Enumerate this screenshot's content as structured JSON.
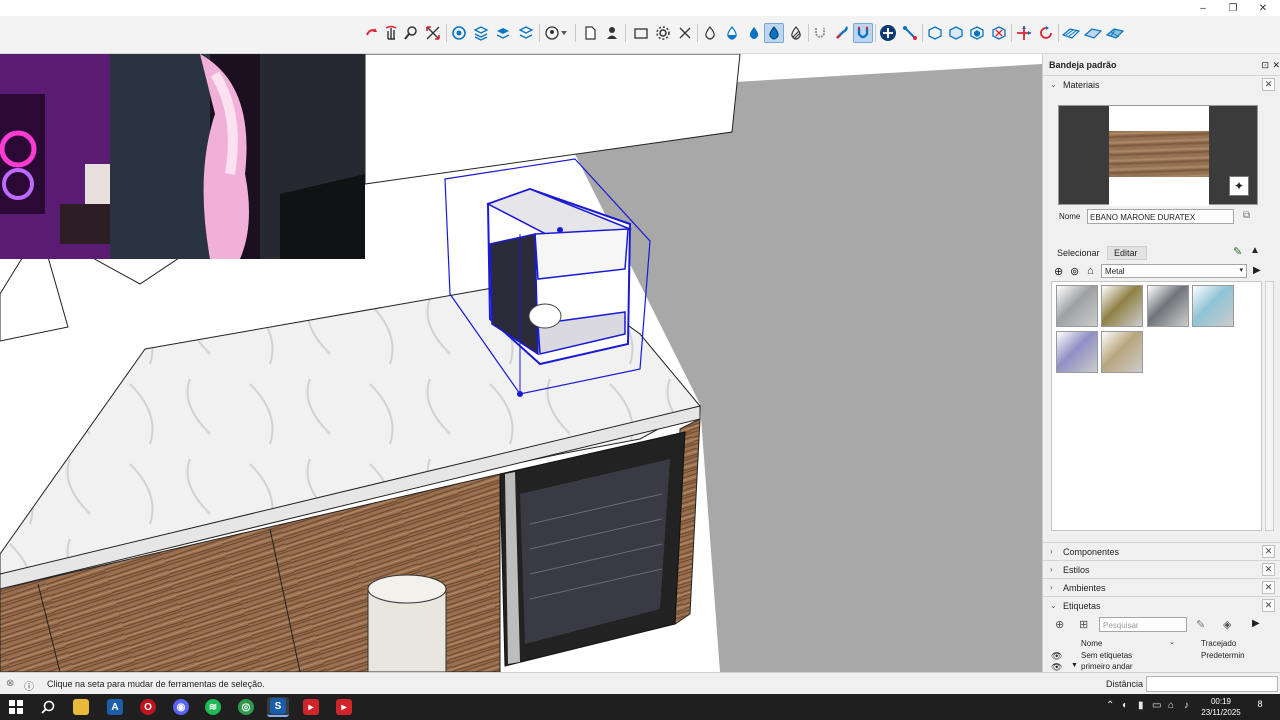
{
  "window": {
    "minimize": "–",
    "restore": "❐",
    "close": "✕"
  },
  "tray": {
    "title": "Bandeja padrão",
    "materials": {
      "title": "Materiais",
      "name_label": "Nome",
      "name_value": "EBANO MARONE DURATEX",
      "tab_select": "Selecionar",
      "tab_edit": "Editar",
      "library": "Metal",
      "swatches": [
        {
          "name": "swatch-metal-silver",
          "color": "#9ea0a3"
        },
        {
          "name": "swatch-metal-gold",
          "color": "#8f8246"
        },
        {
          "name": "swatch-metal-dark",
          "color": "#6f7479"
        },
        {
          "name": "swatch-metal-lightblue",
          "color": "#8fc3d6"
        },
        {
          "name": "swatch-metal-violet",
          "color": "#8f8fc4"
        },
        {
          "name": "swatch-metal-champagne",
          "color": "#b8a67e"
        }
      ]
    },
    "sections": [
      "Componentes",
      "Estilos",
      "Ambientes"
    ],
    "tags": {
      "title": "Etiquetas",
      "search_placeholder": "Pesquisar",
      "col_name": "Nome",
      "col_dash": "Tracejado",
      "rows": [
        {
          "name": "Sem etiquetas",
          "dash": "Predetermin"
        },
        {
          "name": "primeiro andar",
          "dash": ""
        }
      ]
    }
  },
  "status": {
    "hint": "Clique na seta para mudar de ferramentas de seleção.",
    "measure_label": "Distância",
    "measure_value": ""
  },
  "taskbar": {
    "time": "00:19",
    "date": "23/11/2025",
    "notifications": "8"
  },
  "colors": {
    "selection": "#1a1ad6",
    "wall_gray": "#a8a8a8",
    "accent_blue": "#0a74c4"
  }
}
